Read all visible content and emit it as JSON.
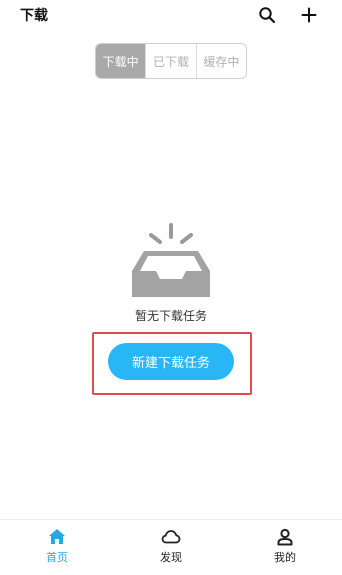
{
  "header": {
    "title": "下载"
  },
  "icons": {
    "search": "search-icon",
    "add": "plus-icon",
    "empty": "empty-inbox-icon",
    "home": "home-icon",
    "discover": "cloud-icon",
    "profile": "person-icon"
  },
  "tabs": [
    {
      "label": "下载中",
      "active": true
    },
    {
      "label": "已下载",
      "active": false
    },
    {
      "label": "缓存中",
      "active": false
    }
  ],
  "empty_state": {
    "message": "暂无下载任务",
    "button_label": "新建下载任务"
  },
  "bottom_nav": [
    {
      "label": "首页",
      "active": true
    },
    {
      "label": "发现",
      "active": false
    },
    {
      "label": "我的",
      "active": false
    }
  ],
  "colors": {
    "accent": "#29b6f6",
    "nav_active": "#29a6e6",
    "highlight": "#e04b4b",
    "tab_active_bg": "#a9a9a9"
  }
}
